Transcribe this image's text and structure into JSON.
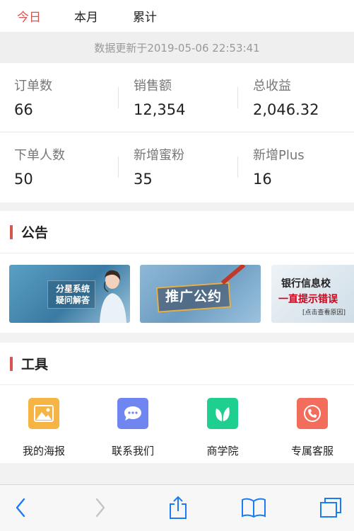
{
  "tabs": [
    {
      "label": "今日",
      "active": true
    },
    {
      "label": "本月",
      "active": false
    },
    {
      "label": "累计",
      "active": false
    }
  ],
  "update_text": "数据更新于2019-05-06 22:53:41",
  "stats": [
    {
      "label": "订单数",
      "value": "66"
    },
    {
      "label": "销售额",
      "value": "12,354"
    },
    {
      "label": "总收益",
      "value": "2,046.32"
    },
    {
      "label": "下单人数",
      "value": "50"
    },
    {
      "label": "新增蜜粉",
      "value": "35"
    },
    {
      "label": "新增Plus",
      "value": "16"
    }
  ],
  "notice": {
    "title": "公告",
    "banners": [
      {
        "icon": "customer-service-banner",
        "lines": [
          "分星系统",
          "疑问解答"
        ]
      },
      {
        "icon": "promotion-agreement-banner",
        "text": "推广公约"
      },
      {
        "icon": "bank-verify-banner",
        "lines": [
          "银行信息校",
          "一直提示错误",
          "[点击查看原因]"
        ]
      }
    ]
  },
  "tools": {
    "title": "工具",
    "items": [
      {
        "label": "我的海报",
        "icon": "poster-icon",
        "color": "#f5b443"
      },
      {
        "label": "联系我们",
        "icon": "chat-icon",
        "color": "#6f86f0"
      },
      {
        "label": "商学院",
        "icon": "leaf-icon",
        "color": "#1fcf8f"
      },
      {
        "label": "专属客服",
        "icon": "phone-icon",
        "color": "#f26d5b"
      }
    ]
  },
  "accent_color": "#d9534f",
  "browser_toolbar": [
    "back-icon",
    "forward-icon",
    "share-icon",
    "bookmarks-icon",
    "tabs-icon"
  ]
}
